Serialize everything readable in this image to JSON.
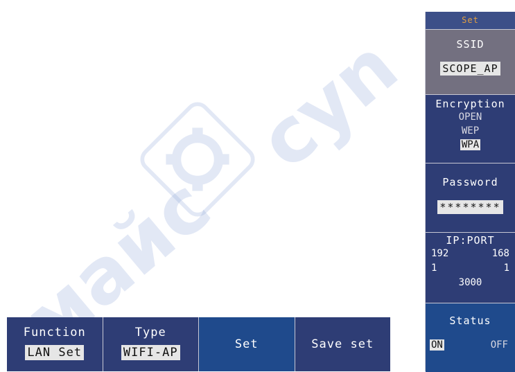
{
  "watermark": {
    "text_1": "майс",
    "text_2": "cyn"
  },
  "side_menu": {
    "title": "Set",
    "ssid": {
      "label": "SSID",
      "value": "SCOPE_AP"
    },
    "encryption": {
      "label": "Encryption",
      "options": [
        "OPEN",
        "WEP",
        "WPA"
      ],
      "selected": "WPA"
    },
    "password": {
      "label": "Password",
      "value": "********"
    },
    "ip_port": {
      "label": "IP:PORT",
      "ip": [
        "192",
        "168",
        "1",
        "1"
      ],
      "port": "3000"
    },
    "status": {
      "label": "Status",
      "on": "ON",
      "off": "OFF",
      "selected": "ON"
    }
  },
  "bottom_bar": {
    "function_label": "Function",
    "function_value": "LAN Set",
    "type_label": "Type",
    "type_value": "WIFI-AP",
    "set_label": "Set",
    "save_label": "Save set"
  },
  "colors": {
    "menu_bg": "#2e3d75",
    "selected_bg": "#1f4a8c",
    "highlight_item": "#737080",
    "title_text": "#e4a040"
  }
}
